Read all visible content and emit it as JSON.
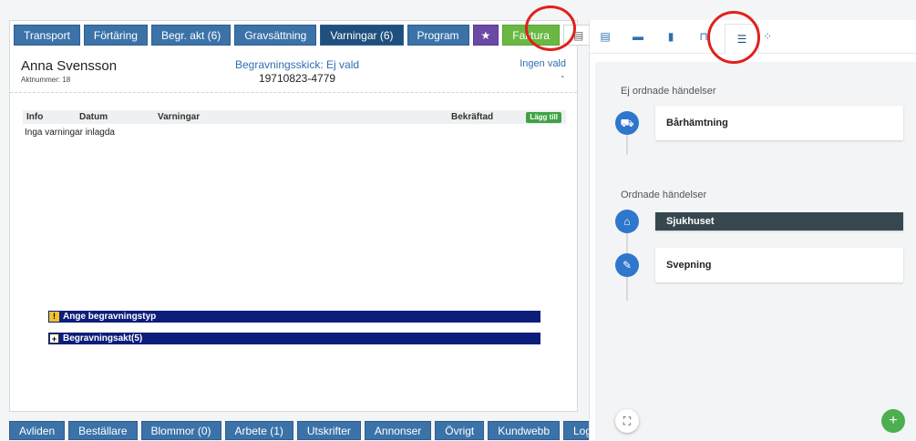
{
  "top_tabs": [
    {
      "label": "Transport"
    },
    {
      "label": "Förtäring"
    },
    {
      "label": "Begr. akt (6)"
    },
    {
      "label": "Gravsättning"
    },
    {
      "label": "Varningar (6)"
    },
    {
      "label": "Program"
    },
    {
      "label": "★"
    },
    {
      "label": "Faktura"
    },
    {
      "label": "▤"
    }
  ],
  "header": {
    "name": "Anna Svensson",
    "aktnummer": "Aktnummer: 18",
    "begravningsskick": "Begravningsskick: Ej vald",
    "personnummer": "19710823-4779",
    "ingen_vald": "Ingen vald",
    "dash": "-"
  },
  "warnings_table": {
    "columns": [
      "Info",
      "Datum",
      "Varningar",
      "Bekräftad"
    ],
    "add_label": "Lägg till",
    "empty_text": "Inga varningar inlagda"
  },
  "bars": {
    "ange_label": "Ange begravningstyp",
    "akt_label": "Begravningsakt(5)"
  },
  "bottom_tabs": [
    {
      "label": "Avliden"
    },
    {
      "label": "Beställare"
    },
    {
      "label": "Blommor (0)"
    },
    {
      "label": "Arbete (1)"
    },
    {
      "label": "Utskrifter"
    },
    {
      "label": "Annonser"
    },
    {
      "label": "Övrigt"
    },
    {
      "label": "Kundwebb"
    },
    {
      "label": "Logg"
    }
  ],
  "right_panel": {
    "unordered_title": "Ej ordnade händelser",
    "ordered_title": "Ordnade händelser",
    "events_unordered": [
      {
        "label": "Bårhämtning"
      }
    ],
    "events_ordered": [
      {
        "label": "Sjukhuset"
      },
      {
        "label": "Svepning"
      }
    ]
  },
  "colors": {
    "accent": "#3b72a8",
    "active": "#1f4f7c",
    "green": "#69b843",
    "highlight": "#e0201c"
  }
}
